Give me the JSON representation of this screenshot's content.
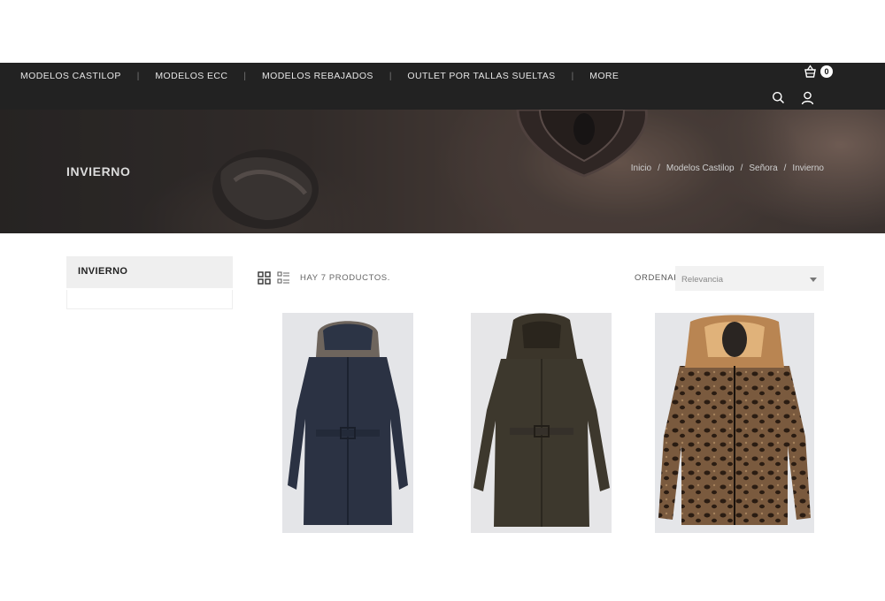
{
  "nav": {
    "links": [
      "MODELOS CASTILOP",
      "MODELOS ECC",
      "MODELOS REBAJADOS",
      "OUTLET POR TALLAS SUELTAS",
      "MORE"
    ],
    "separator": "|",
    "cart_count": "0",
    "icons": [
      "shopping-basket-icon",
      "search-icon",
      "user-icon"
    ]
  },
  "hero": {
    "title": "INVIERNO",
    "breadcrumb": [
      "Inicio",
      "Modelos Castilop",
      "Señora",
      "Invierno"
    ],
    "breadcrumb_separator": "/"
  },
  "sidebar": {
    "title": "INVIERNO"
  },
  "toolbar": {
    "count_text": "HAY 7 PRODUCTOS.",
    "sort_label": "ORDENAR POR:",
    "sort_value": "Relevancia",
    "view_icons": [
      "grid-view-icon",
      "list-view-icon"
    ]
  },
  "products": [
    {
      "description": "navy quilted coat with fur-trimmed hood and belt"
    },
    {
      "description": "dark olive hooded quilted coat with belt"
    },
    {
      "description": "leopard print jacket with fur collar"
    }
  ],
  "colors": {
    "navbar": "#222222",
    "nav_text": "#e6e6e6",
    "sidebar_bg": "#efefef",
    "sort_bg": "#f2f2f2"
  }
}
